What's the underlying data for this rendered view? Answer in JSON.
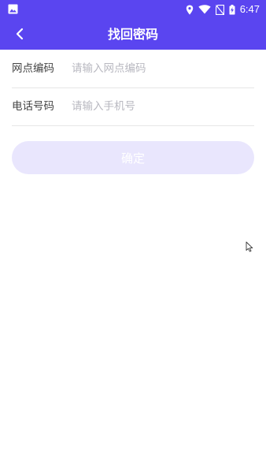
{
  "status_bar": {
    "time": "6:47",
    "icons": [
      "image-icon",
      "location-icon",
      "wifi-icon",
      "no-sim-icon",
      "battery-charging-icon"
    ]
  },
  "header": {
    "title": "找回密码",
    "back_icon": "chevron-left-icon"
  },
  "form": {
    "network_code": {
      "label": "网点编码",
      "value": "",
      "placeholder": "请输入网点编码"
    },
    "phone": {
      "label": "电话号码",
      "value": "",
      "placeholder": "请输入手机号"
    },
    "confirm_label": "确定"
  },
  "colors": {
    "brand": "#5a45f0",
    "button_disabled_bg": "#e9e6fd",
    "placeholder": "#b8b8c0",
    "divider": "#e6e6e6"
  }
}
